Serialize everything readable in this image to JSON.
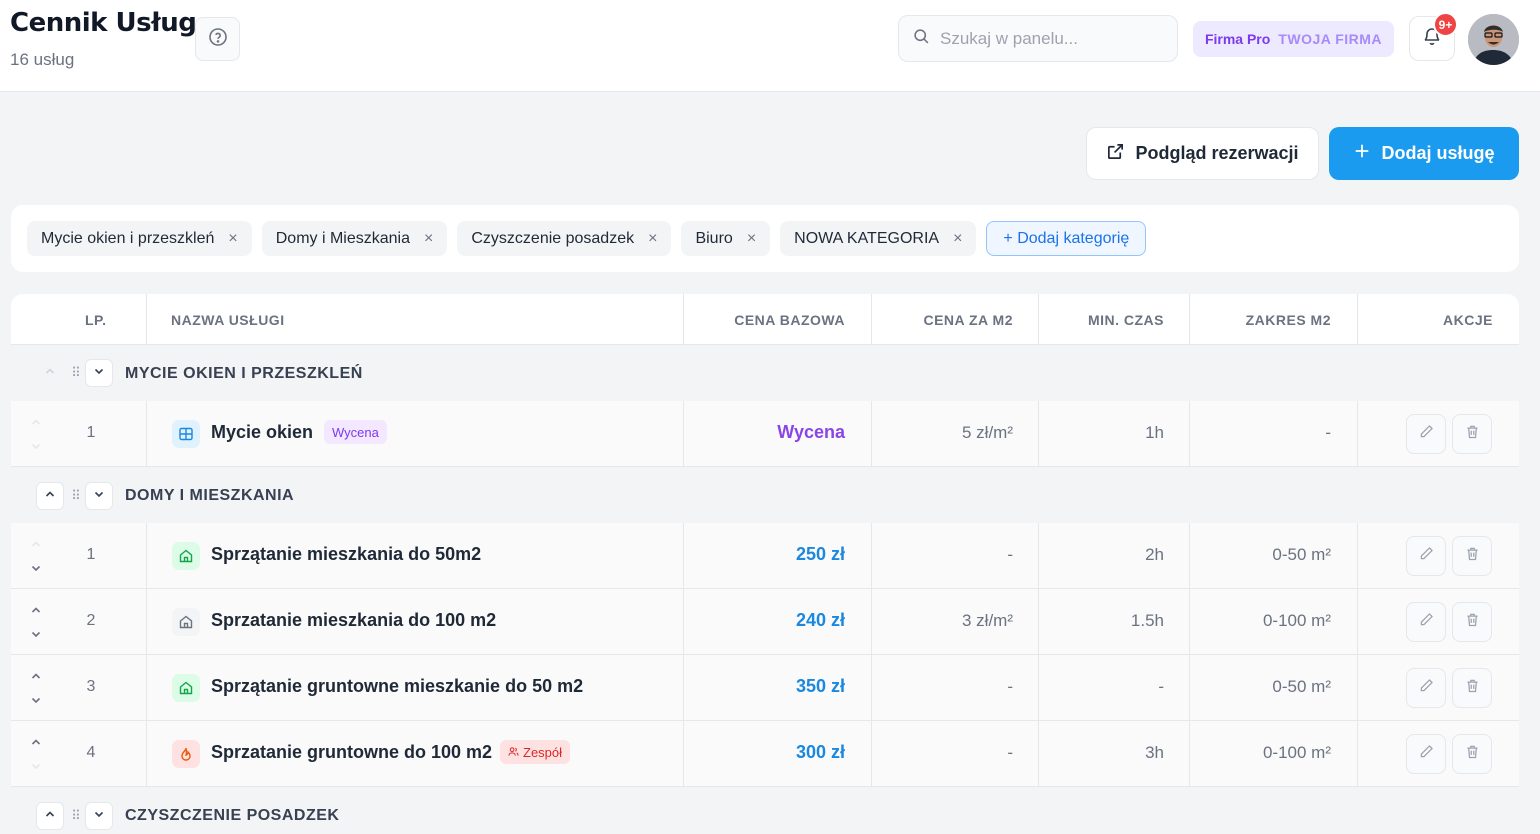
{
  "header": {
    "title": "Cennik Usług",
    "subtitle": "16 usług",
    "search_placeholder": "Szukaj w panelu...",
    "plan_label": "Firma Pro",
    "company_label": "TWOJA FIRMA",
    "notifications_badge": "9+"
  },
  "actions": {
    "preview_label": "Podgląd rezerwacji",
    "add_label": "Dodaj usługę"
  },
  "categories": {
    "chips": [
      "Mycie okien i przeszkleń",
      "Domy i Mieszkania",
      "Czyszczenie posadzek",
      "Biuro",
      "NOWA KATEGORIA"
    ],
    "add_label": "+ Dodaj kategorię"
  },
  "table": {
    "columns": {
      "lp": "LP.",
      "name": "NAZWA USŁUGI",
      "base_price": "CENA BAZOWA",
      "price_m2": "CENA ZA M2",
      "min_time": "MIN. CZAS",
      "range_m2": "ZAKRES M2",
      "actions": "AKCJE"
    },
    "groups": [
      {
        "name": "MYCIE OKIEN I PRZESZKLEŃ",
        "rows": [
          {
            "lp": "1",
            "name": "Mycie okien",
            "tag": "Wycena",
            "base_price": "Wycena",
            "price_m2": "5 zł/m²",
            "min_time": "1h",
            "range_m2": "-"
          }
        ]
      },
      {
        "name": "DOMY I MIESZKANIA",
        "rows": [
          {
            "lp": "1",
            "name": "Sprzątanie mieszkania do 50m2",
            "base_price": "250 zł",
            "price_m2": "-",
            "min_time": "2h",
            "range_m2": "0-50 m²"
          },
          {
            "lp": "2",
            "name": "Sprzatanie mieszkania do 100 m2",
            "base_price": "240 zł",
            "price_m2": "3 zł/m²",
            "min_time": "1.5h",
            "range_m2": "0-100 m²"
          },
          {
            "lp": "3",
            "name": "Sprzątanie gruntowne mieszkanie do 50 m2",
            "base_price": "350 zł",
            "price_m2": "-",
            "min_time": "-",
            "range_m2": "0-50 m²"
          },
          {
            "lp": "4",
            "name": "Sprzatanie gruntowne do 100 m2",
            "tag": "Zespół",
            "base_price": "300 zł",
            "price_m2": "-",
            "min_time": "3h",
            "range_m2": "0-100 m²"
          }
        ]
      },
      {
        "name": "CZYSZCZENIE POSADZEK",
        "rows": []
      }
    ]
  },
  "colors": {
    "accent": "#1a9bf0",
    "price_blue": "#1a88e0",
    "quote_purple": "#8b45e6",
    "badge_red": "#ef4444"
  },
  "icons": [
    "help-circle-icon",
    "search-icon",
    "bell-icon",
    "external-link-icon",
    "plus-icon",
    "close-icon",
    "grid-window-icon",
    "home-icon",
    "flame-icon",
    "users-icon",
    "pencil-icon",
    "trash-icon",
    "chevron-up-icon",
    "chevron-down-icon",
    "drag-handle-icon"
  ]
}
